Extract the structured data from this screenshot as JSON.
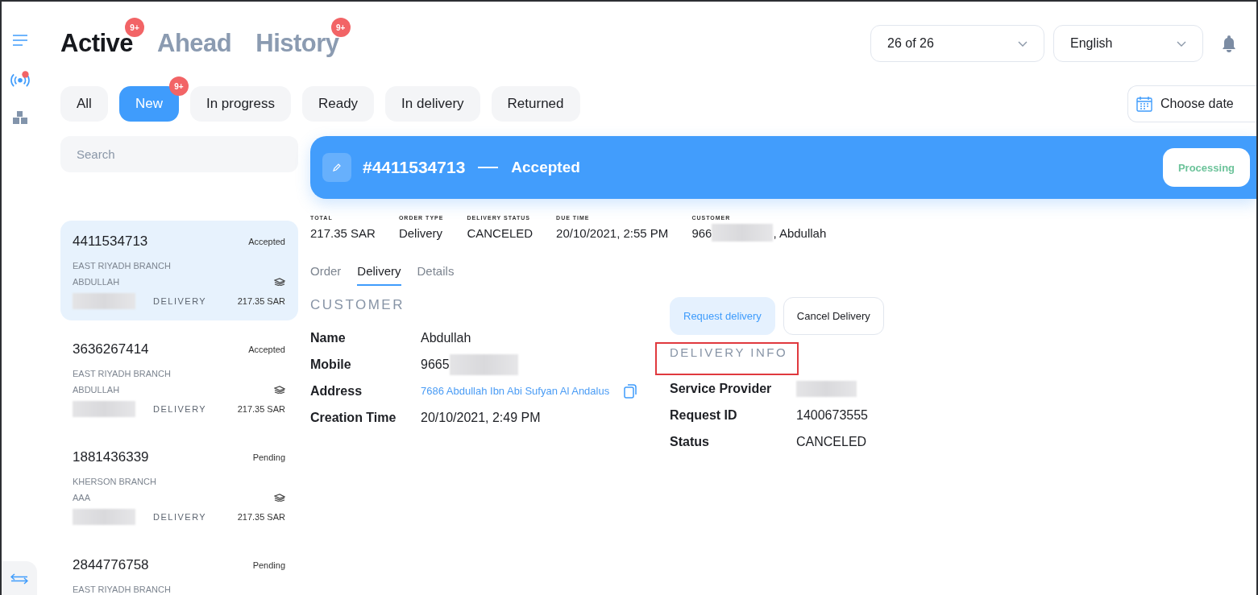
{
  "view_tabs": [
    {
      "label": "Active",
      "selected": true,
      "badge": "9+"
    },
    {
      "label": "Ahead",
      "selected": false
    },
    {
      "label": "History",
      "selected": false,
      "badge": "9+"
    }
  ],
  "branch_select": {
    "value": "26 of 26"
  },
  "language_select": {
    "value": "English"
  },
  "status_filters": [
    {
      "label": "All",
      "selected": false
    },
    {
      "label": "New",
      "selected": true,
      "badge": "9+"
    },
    {
      "label": "In progress",
      "selected": false
    },
    {
      "label": "Ready",
      "selected": false
    },
    {
      "label": "In delivery",
      "selected": false
    },
    {
      "label": "Returned",
      "selected": false
    }
  ],
  "date_picker": {
    "label": "Choose date"
  },
  "search": {
    "placeholder": "Search"
  },
  "orders": [
    {
      "number": "4411534713",
      "status": "Accepted",
      "branch": "EAST RIYADH BRANCH",
      "customer": "ABDULLAH",
      "type": "DELIVERY",
      "total": "217.35 SAR",
      "selected": true
    },
    {
      "number": "3636267414",
      "status": "Accepted",
      "branch": "EAST RIYADH BRANCH",
      "customer": "ABDULLAH",
      "type": "DELIVERY",
      "total": "217.35 SAR",
      "selected": false
    },
    {
      "number": "1881436339",
      "status": "Pending",
      "branch": "KHERSON BRANCH",
      "customer": "AAA",
      "type": "DELIVERY",
      "total": "217.35 SAR",
      "selected": false
    },
    {
      "number": "2844776758",
      "status": "Pending",
      "branch": "EAST RIYADH BRANCH",
      "selected": false
    }
  ],
  "order_detail": {
    "number": "#4411534713",
    "status": "Accepted",
    "action": "Processing",
    "summary": [
      {
        "label": "TOTAL",
        "value": "217.35 SAR"
      },
      {
        "label": "ORDER TYPE",
        "value": "Delivery"
      },
      {
        "label": "DELIVERY STATUS",
        "value": "CANCELED"
      },
      {
        "label": "DUE TIME",
        "value": "20/10/2021, 2:55 PM"
      },
      {
        "label": "CUSTOMER",
        "value": "966",
        "value_after": ", Abdullah",
        "redacted": true
      }
    ]
  },
  "detail_tabs": [
    {
      "label": "Order",
      "selected": false
    },
    {
      "label": "Delivery",
      "selected": true
    },
    {
      "label": "Details",
      "selected": false
    }
  ],
  "customer": {
    "title": "CUSTOMER",
    "fields": [
      {
        "label": "Name",
        "value": "Abdullah",
        "kind": "text"
      },
      {
        "label": "Mobile",
        "value": "9665",
        "kind": "masked"
      },
      {
        "label": "Address",
        "value": "7686 Abdullah Ibn Abi Sufyan Al Andalus",
        "kind": "link"
      },
      {
        "label": "Creation Time",
        "value": "20/10/2021, 2:49 PM",
        "kind": "text"
      }
    ]
  },
  "delivery_actions": [
    {
      "label": "Request delivery",
      "kind": "primary"
    },
    {
      "label": "Cancel Delivery",
      "kind": "outline"
    }
  ],
  "delivery_info": {
    "title": "DELIVERY INFO",
    "highlighted": true,
    "fields": [
      {
        "label": "Service Provider",
        "kind": "masked"
      },
      {
        "label": "Request ID",
        "value": "1400673555",
        "kind": "text"
      },
      {
        "label": "Status",
        "value": "CANCELED",
        "kind": "text"
      }
    ]
  }
}
